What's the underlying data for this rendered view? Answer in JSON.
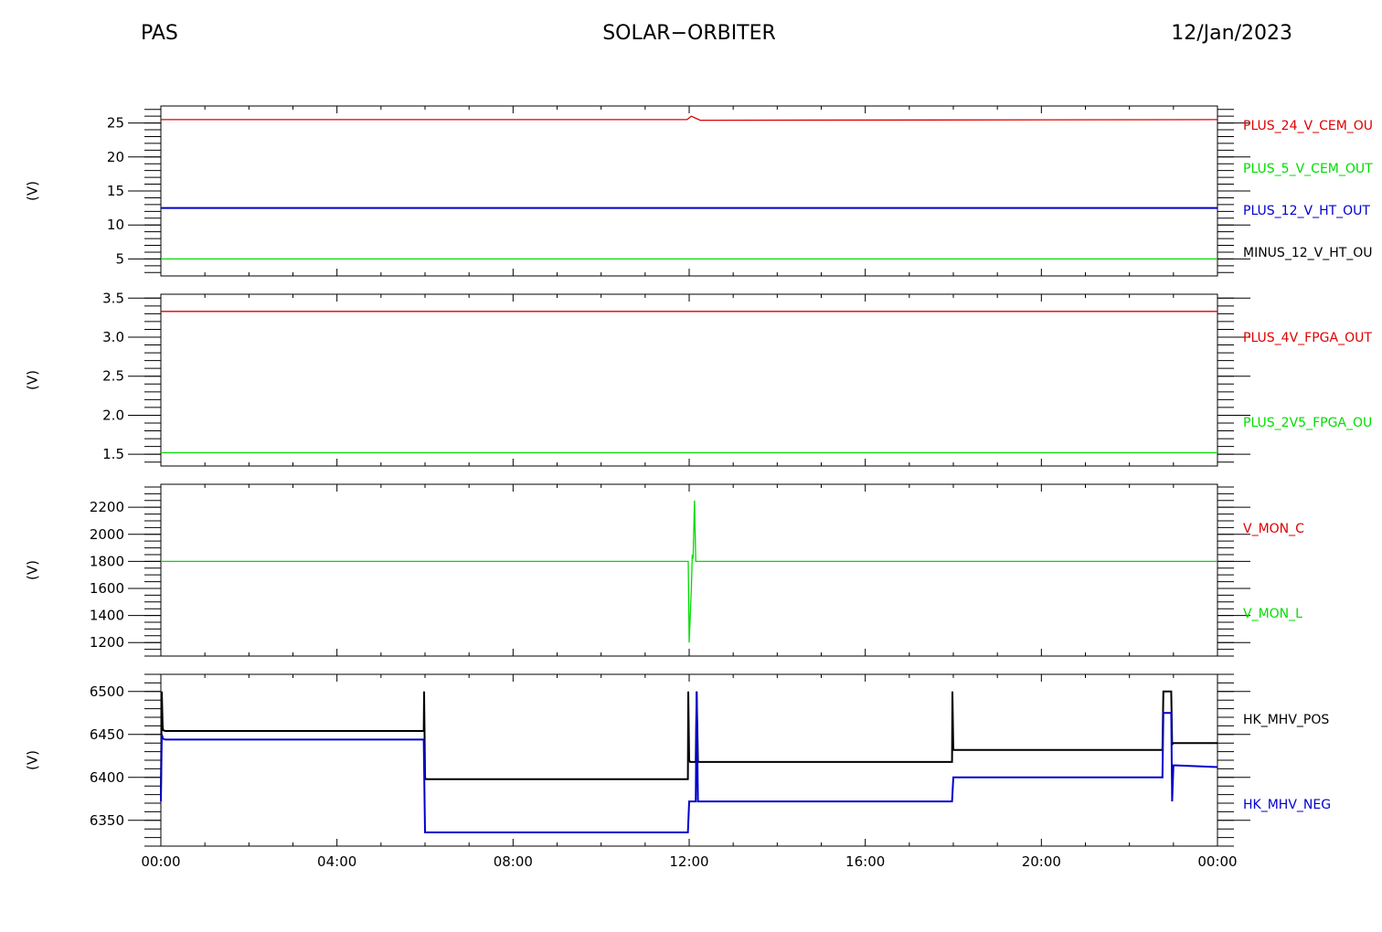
{
  "header": {
    "left": "PAS",
    "center": "SOLAR−ORBITER",
    "right": "12/Jan/2023"
  },
  "colors": {
    "red": "#dd0000",
    "green": "#00dd00",
    "blue": "#0000cc",
    "black": "#000000"
  },
  "chart_data": [
    {
      "type": "line",
      "ylabel": "(V)",
      "ylim": [
        2.5,
        27.5
      ],
      "yticks": [
        5,
        10,
        15,
        20,
        25
      ],
      "ytick_labels": [
        "5",
        "10",
        "15",
        "20",
        "25"
      ],
      "minor_step": 1,
      "xlim_hours": [
        0,
        24
      ],
      "series": [
        {
          "name": "PLUS_24_V_CEM_OUT",
          "label": "PLUS_24_V_CEM_OU",
          "color": "red",
          "x": [
            0,
            11.95,
            12.05,
            12.25,
            24
          ],
          "y": [
            25.5,
            25.5,
            26.0,
            25.4,
            25.5
          ]
        },
        {
          "name": "PLUS_5_V_CEM_OUT",
          "label": "PLUS_5_V_CEM_OUT",
          "color": "green",
          "x": [
            0,
            24
          ],
          "y": [
            5.0,
            5.0
          ]
        },
        {
          "name": "PLUS_12_V_HT_OUT",
          "label": "PLUS_12_V_HT_OUT",
          "color": "blue",
          "x": [
            0,
            24
          ],
          "y": [
            12.5,
            12.5
          ]
        },
        {
          "name": "MINUS_12_V_HT_OUT",
          "label": "MINUS_12_V_HT_OU",
          "color": "black",
          "x": [],
          "y": []
        }
      ]
    },
    {
      "type": "line",
      "ylabel": "(V)",
      "ylim": [
        1.35,
        3.55
      ],
      "yticks": [
        1.5,
        2.0,
        2.5,
        3.0,
        3.5
      ],
      "ytick_labels": [
        "1.5",
        "2.0",
        "2.5",
        "3.0",
        "3.5"
      ],
      "minor_step": 0.1,
      "xlim_hours": [
        0,
        24
      ],
      "series": [
        {
          "name": "PLUS_4V_FPGA_OUT",
          "label": "PLUS_4V_FPGA_OUT",
          "color": "red",
          "x": [
            0,
            24
          ],
          "y": [
            3.33,
            3.33
          ]
        },
        {
          "name": "PLUS_2V5_FPGA_OUT",
          "label": "PLUS_2V5_FPGA_OU",
          "color": "green",
          "x": [
            0,
            24
          ],
          "y": [
            1.52,
            1.52
          ]
        }
      ]
    },
    {
      "type": "line",
      "ylabel": "(V)",
      "ylim": [
        1100,
        2370
      ],
      "yticks": [
        1200,
        1400,
        1600,
        1800,
        2000,
        2200
      ],
      "ytick_labels": [
        "1200",
        "1400",
        "1600",
        "1800",
        "2000",
        "2200"
      ],
      "minor_step": 50,
      "xlim_hours": [
        0,
        24
      ],
      "series": [
        {
          "name": "V_MON_C",
          "label": "V_MON_C",
          "color": "red",
          "x": [],
          "y": []
        },
        {
          "name": "V_MON_L",
          "label": "V_MON_L",
          "color": "green",
          "x": [
            0,
            11.98,
            12.0,
            12.05,
            12.07,
            12.09,
            12.12,
            12.15,
            12.18,
            24
          ],
          "y": [
            1800,
            1800,
            1200,
            1600,
            1850,
            1820,
            2250,
            1800,
            1800,
            1800
          ]
        }
      ]
    },
    {
      "type": "line",
      "ylabel": "(V)",
      "ylim": [
        6320,
        6520
      ],
      "yticks": [
        6350,
        6400,
        6450,
        6500
      ],
      "ytick_labels": [
        "6350",
        "6400",
        "6450",
        "6500"
      ],
      "minor_step": 10,
      "xlim_hours": [
        0,
        24
      ],
      "xticks": [
        0,
        4,
        8,
        12,
        16,
        20,
        24
      ],
      "xtick_labels": [
        "00:00",
        "04:00",
        "08:00",
        "12:00",
        "16:00",
        "20:00",
        "00:00"
      ],
      "series": [
        {
          "name": "HK_MHV_POS",
          "label": "HK_MHV_POS",
          "color": "black",
          "x": [
            0,
            0.02,
            0.04,
            0.05,
            0.1,
            5.97,
            5.98,
            6.0,
            6.02,
            6.05,
            11.97,
            11.98,
            12.0,
            12.02,
            12.05,
            12.15,
            12.17,
            12.2,
            12.22,
            17.97,
            17.98,
            18.0,
            18.02,
            18.05,
            22.75,
            22.77,
            22.95,
            22.97,
            22.99,
            23.05,
            24
          ],
          "y": [
            6380,
            6500,
            6460,
            6455,
            6454,
            6454,
            6500,
            6400,
            6398,
            6398,
            6398,
            6500,
            6420,
            6418,
            6418,
            6418,
            6500,
            6419,
            6418,
            6418,
            6500,
            6432,
            6432,
            6432,
            6432,
            6500,
            6500,
            6438,
            6440,
            6440,
            6440
          ]
        },
        {
          "name": "HK_MHV_NEG",
          "label": "HK_MHV_NEG",
          "color": "blue",
          "x": [
            0,
            0.02,
            0.05,
            0.1,
            5.97,
            6.0,
            6.02,
            6.05,
            11.97,
            12.0,
            12.02,
            12.05,
            12.15,
            12.17,
            12.2,
            12.22,
            17.97,
            18.0,
            18.02,
            18.05,
            22.75,
            22.77,
            22.95,
            22.97,
            23.0,
            23.05,
            24
          ],
          "y": [
            6372,
            6450,
            6445,
            6444,
            6444,
            6336,
            6336,
            6336,
            6336,
            6372,
            6372,
            6372,
            6372,
            6500,
            6372,
            6372,
            6372,
            6400,
            6400,
            6400,
            6400,
            6475,
            6475,
            6372,
            6414,
            6414,
            6412
          ]
        }
      ]
    }
  ]
}
